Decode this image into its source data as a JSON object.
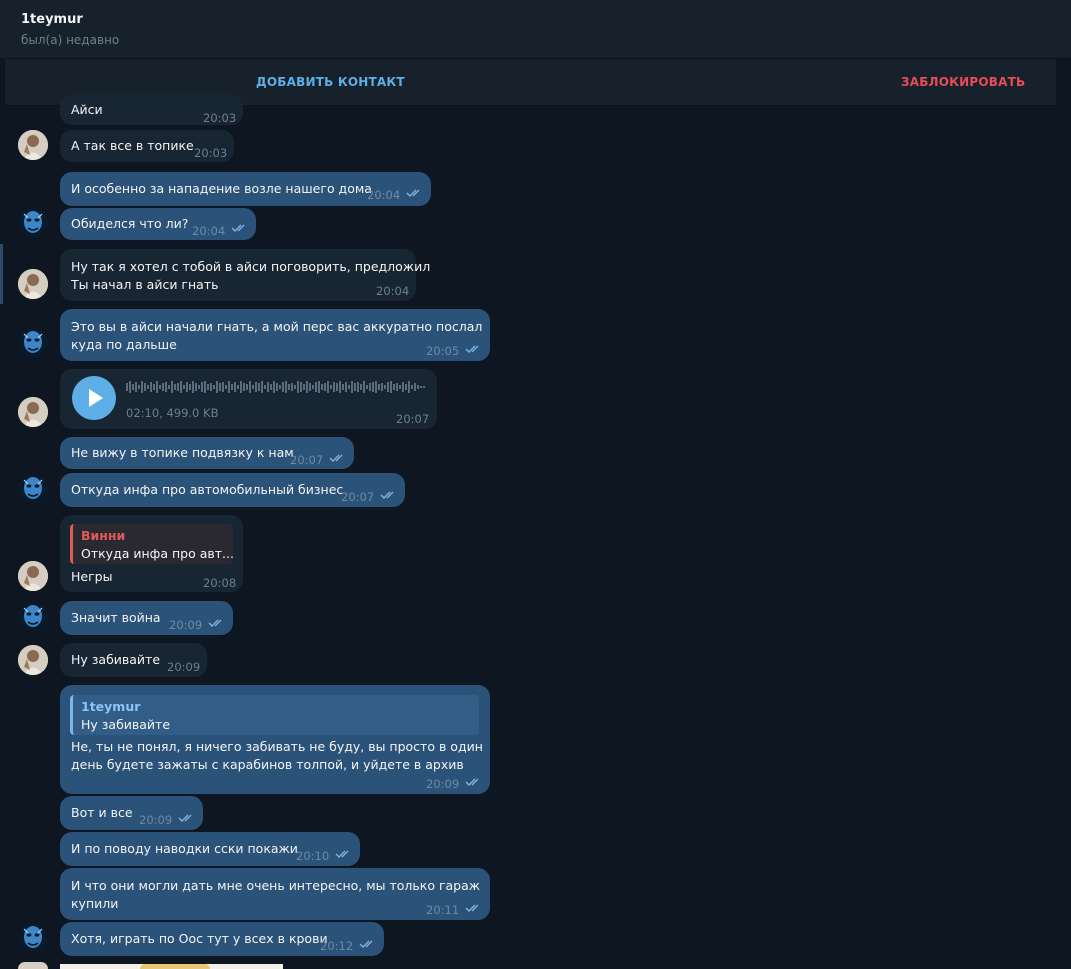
{
  "header": {
    "title": "1teymur",
    "status": "был(а) недавно"
  },
  "actions": {
    "add_contact": "ДОБАВИТЬ КОНТАКТ",
    "block": "ЗАБЛОКИРОВАТЬ"
  },
  "colors": {
    "background": "#0e1621",
    "incoming": "#182533",
    "outgoing": "#2b5278",
    "accent": "#5eaee8",
    "danger": "#e64d5a"
  },
  "messages": [
    {
      "text": "Айси",
      "time": "20:03"
    },
    {
      "text": "А так все в топике",
      "time": "20:03"
    },
    {
      "text": "И особенно за нападение возле нашего дома",
      "time": "20:04"
    },
    {
      "text": "Обиделся что ли?",
      "time": "20:04"
    },
    {
      "line1": "Ну так я хотел с тобой в айси поговорить, предложил",
      "line2": "Ты начал в айси гнать",
      "time": "20:04"
    },
    {
      "line1": "Это вы в айси начали гнать, а мой перс вас аккуратно послал",
      "line2": "куда по дальше",
      "time": "20:05"
    },
    {
      "voice_meta": "02:10, 499.0 KB",
      "time": "20:07"
    },
    {
      "text": "Не вижу в топике подвязку к нам",
      "time": "20:07"
    },
    {
      "text": "Откуда инфа про автомобильный бизнес",
      "time": "20:07"
    },
    {
      "reply_name": "Винни",
      "reply_text": "Откуда инфа про авт...",
      "text": "Негры",
      "time": "20:08"
    },
    {
      "text": "Значит война",
      "time": "20:09"
    },
    {
      "text": "Ну забивайте",
      "time": "20:09"
    },
    {
      "reply_name": "1teymur",
      "reply_text": "Ну забивайте",
      "line1": "Не, ты не понял, я ничего забивать не буду, вы просто в один",
      "line2": "день будете зажаты с карабинов толпой, и уйдете в архив",
      "time": "20:09"
    },
    {
      "text": "Вот и все",
      "time": "20:09"
    },
    {
      "text": "И по поводу наводки сски покажи",
      "time": "20:10"
    },
    {
      "line1": "И что они могли дать мне очень интересно, мы только гараж",
      "line2": "купили",
      "time": "20:11"
    },
    {
      "text": "Хотя, играть по Оос тут у всех в крови",
      "time": "20:12"
    }
  ]
}
